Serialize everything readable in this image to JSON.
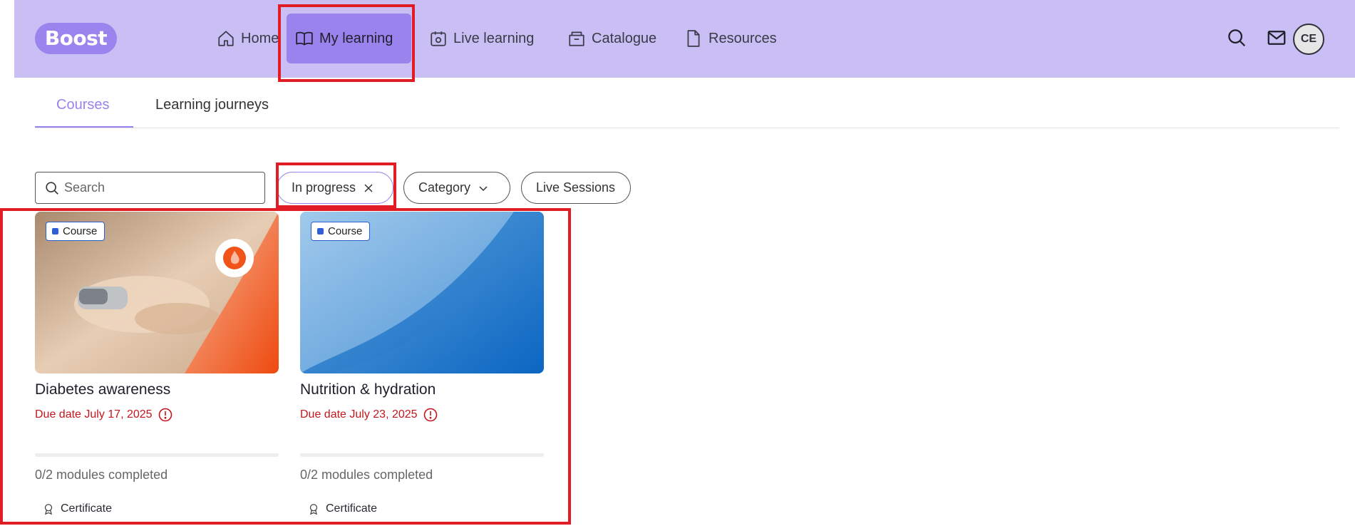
{
  "header": {
    "logo": "Boost",
    "nav": [
      {
        "label": "Home",
        "icon": "home-icon"
      },
      {
        "label": "My learning",
        "icon": "book-icon",
        "active": true
      },
      {
        "label": "Live learning",
        "icon": "calendar-camera-icon"
      },
      {
        "label": "Catalogue",
        "icon": "catalogue-icon"
      },
      {
        "label": "Resources",
        "icon": "document-icon"
      }
    ],
    "avatar_initials": "CE"
  },
  "tabs": [
    {
      "label": "Courses",
      "active": true
    },
    {
      "label": "Learning journeys"
    }
  ],
  "filters": {
    "search_placeholder": "Search",
    "status_chip": "In progress",
    "category_chip": "Category",
    "live_sessions_chip": "Live Sessions"
  },
  "cards": [
    {
      "badge": "Course",
      "title": "Diabetes awareness",
      "due": "Due date July 17, 2025",
      "progress": 0,
      "modules": "0/2 modules completed",
      "certificate": "Certificate"
    },
    {
      "badge": "Course",
      "title": "Nutrition & hydration",
      "due": "Due date July 23, 2025",
      "progress": 0,
      "modules": "0/2 modules completed",
      "certificate": "Certificate"
    }
  ],
  "colors": {
    "header_bg": "#c9bff4",
    "accent": "#9a83ec",
    "due_red": "#c4161c",
    "highlight_red": "#e01d25"
  }
}
